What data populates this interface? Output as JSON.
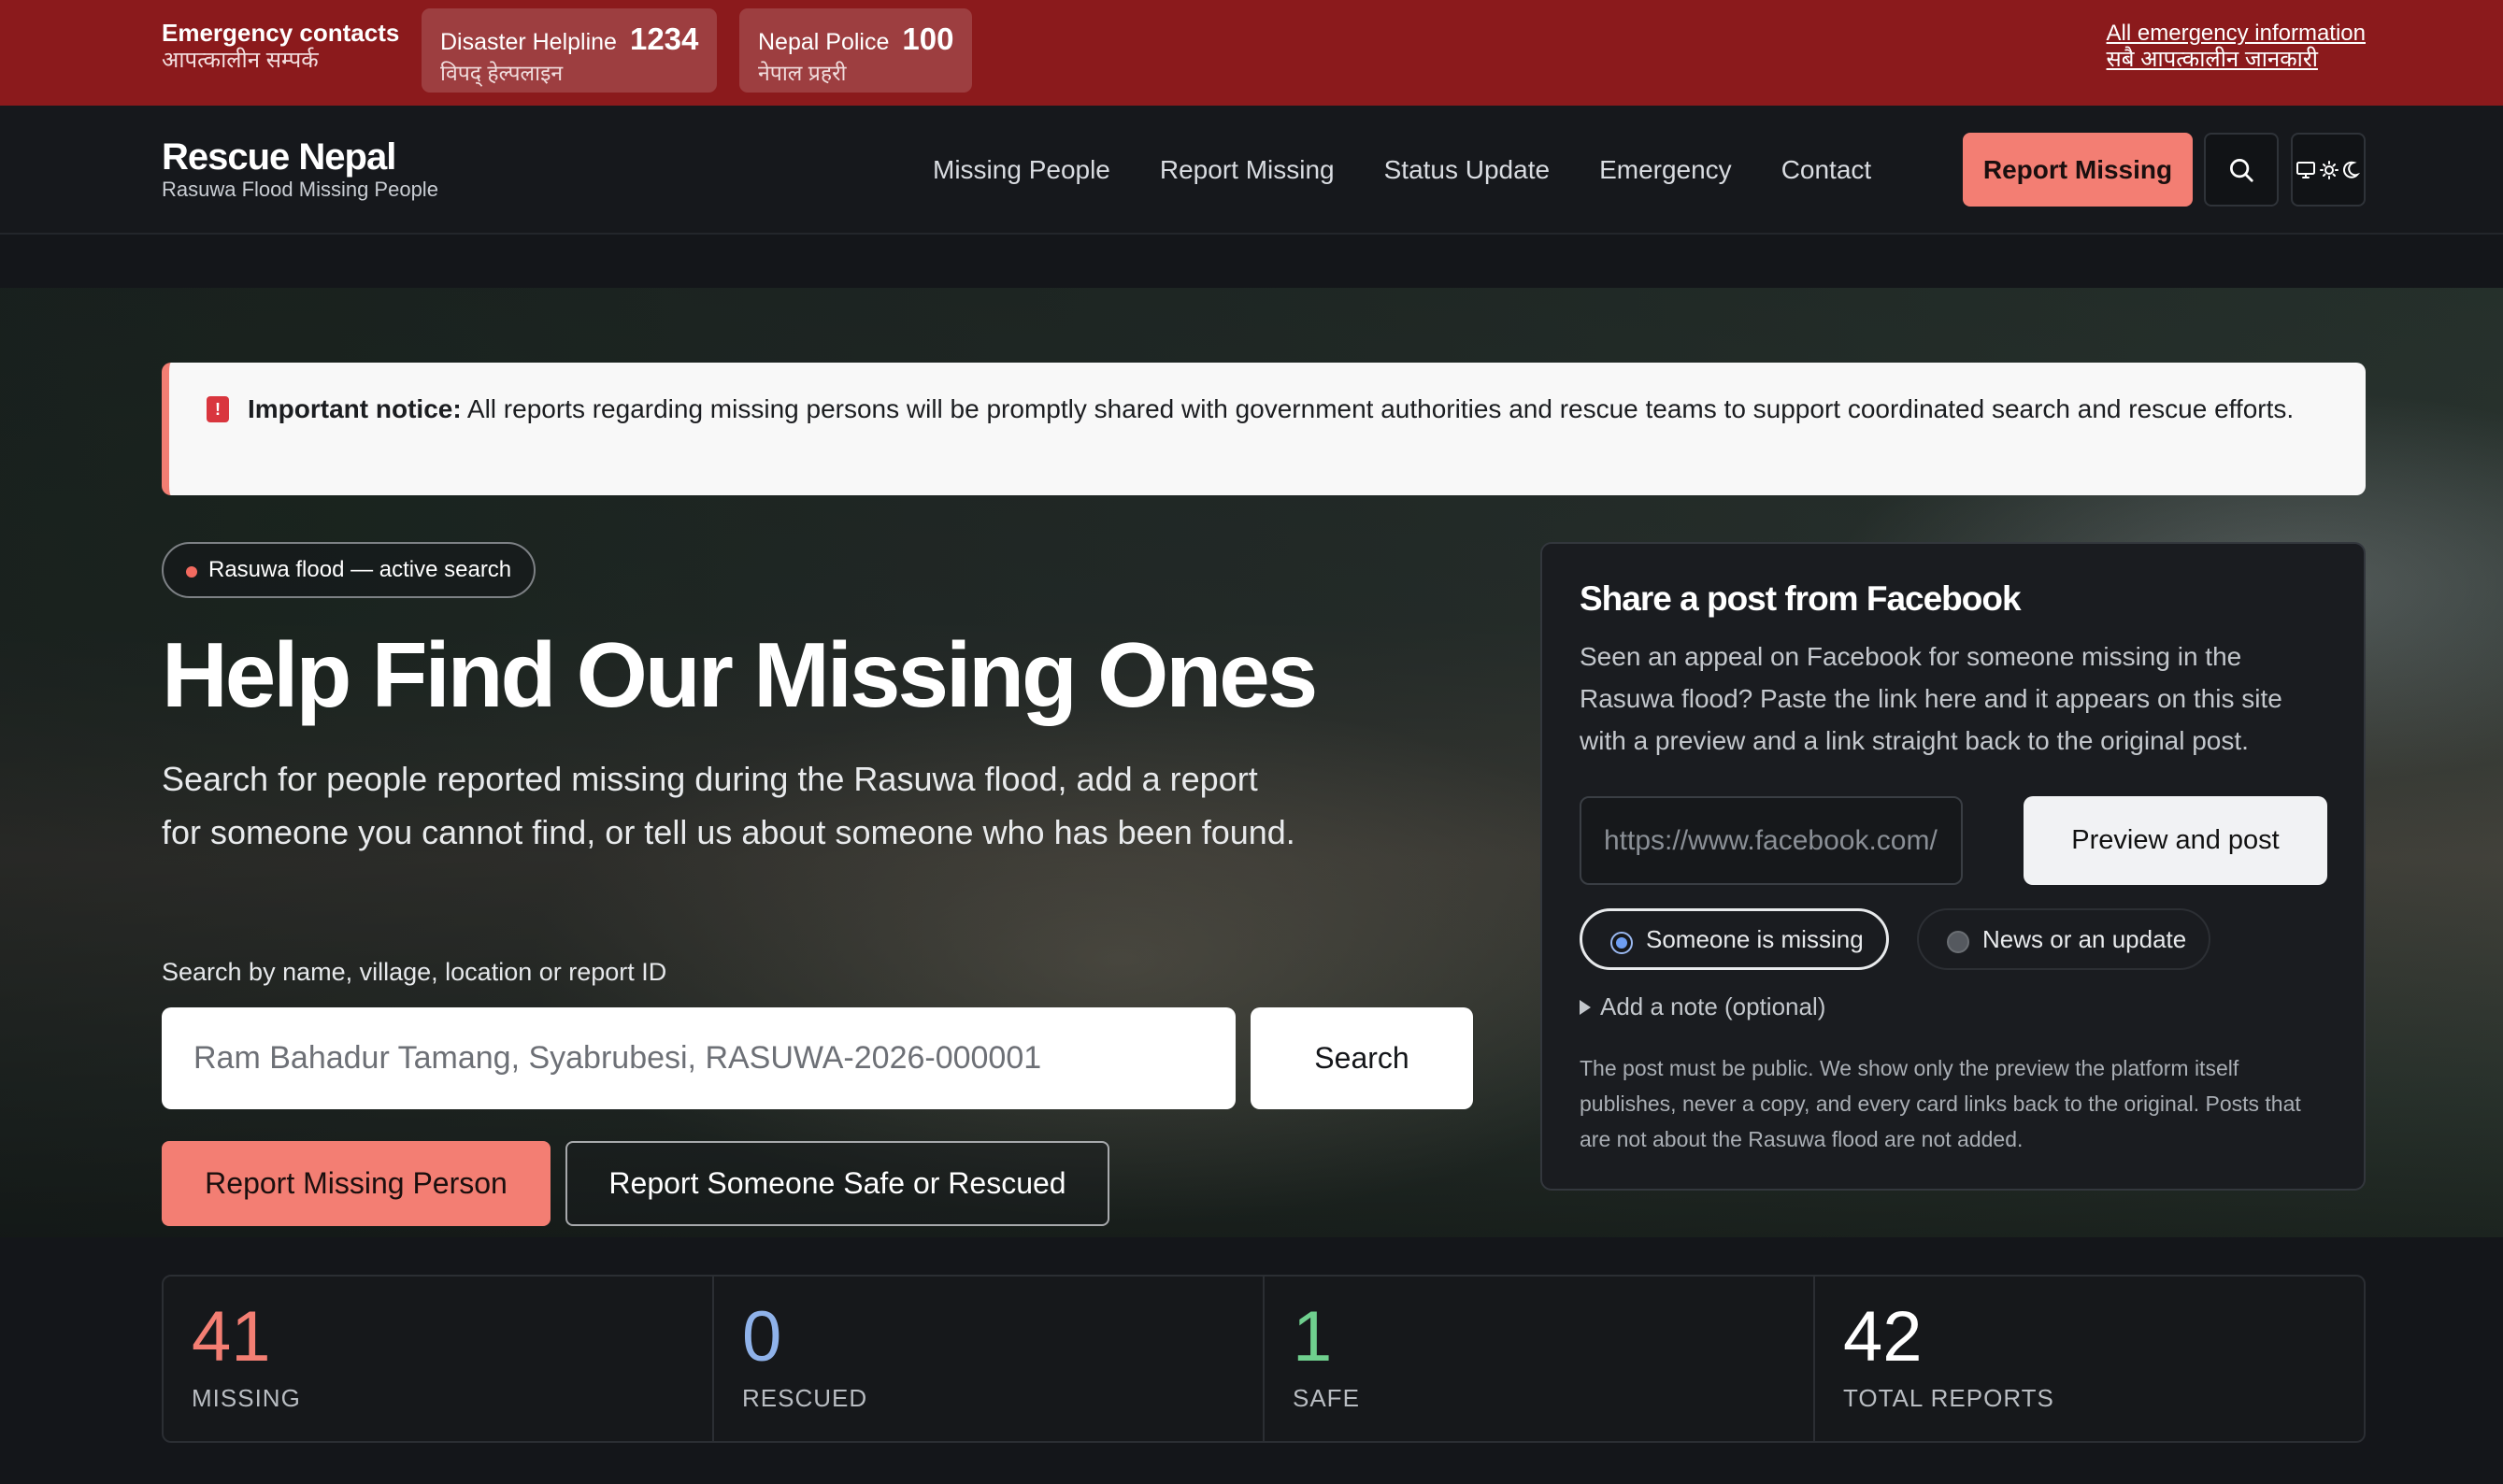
{
  "topbar": {
    "contacts_en": "Emergency contacts",
    "contacts_np": "आपत्कालीन सम्पर्क",
    "helpline": {
      "label": "Disaster Helpline",
      "number": "1234",
      "label_np": "विपद् हेल्पलाइन"
    },
    "police": {
      "label": "Nepal Police",
      "number": "100",
      "label_np": "नेपाल प्रहरी"
    },
    "all_info_en": "All emergency information",
    "all_info_np": "सबै आपत्कालीन जानकारी"
  },
  "nav": {
    "brand_title": "Rescue Nepal",
    "brand_subtitle": "Rasuwa Flood Missing People",
    "links": [
      "Missing People",
      "Report Missing",
      "Status Update",
      "Emergency",
      "Contact"
    ],
    "cta": "Report Missing",
    "icons": [
      "search-icon",
      "theme-toggle-icon"
    ]
  },
  "notice": {
    "title": "Important notice:",
    "text": "All reports regarding missing persons will be promptly shared with government authorities and rescue teams to support coordinated search and rescue efforts."
  },
  "hero": {
    "badge": "Rasuwa flood — active search",
    "title": "Help Find Our Missing Ones",
    "lead": "Search for people reported missing during the Rasuwa flood, add a report for someone you cannot find, or tell us about someone who has been found.",
    "search_label": "Search by name, village, location or report ID",
    "search_placeholder": "Ram Bahadur Tamang, Syabrubesi, RASUWA-2026-000001",
    "search_button": "Search",
    "primary_button": "Report Missing Person",
    "secondary_button": "Report Someone Safe or Rescued"
  },
  "facebook": {
    "title": "Share a post from Facebook",
    "description": "Seen an appeal on Facebook for someone missing in the Rasuwa flood? Paste the link here and it appears on this site with a preview and a link straight back to the original post.",
    "url_placeholder": "https://www.facebook.com/s",
    "preview_button": "Preview and post",
    "option_missing": "Someone is missing",
    "option_news": "News or an update",
    "selected_option": "Someone is missing",
    "note_toggle": "Add a note (optional)",
    "fine_print": "The post must be public. We show only the preview the platform itself publishes, never a copy, and every card links back to the original. Posts that are not about the Rasuwa flood are not added."
  },
  "stats": [
    {
      "value": "41",
      "label": "MISSING",
      "color": "#f37e73"
    },
    {
      "value": "0",
      "label": "RESCUED",
      "color": "#8fb2ea"
    },
    {
      "value": "1",
      "label": "SAFE",
      "color": "#6fcf8e"
    },
    {
      "value": "42",
      "label": "TOTAL REPORTS",
      "color": "#ffffff"
    }
  ],
  "colors": {
    "topbar": "#8b1a1c",
    "accent": "#f37e73",
    "background": "#14161a"
  }
}
